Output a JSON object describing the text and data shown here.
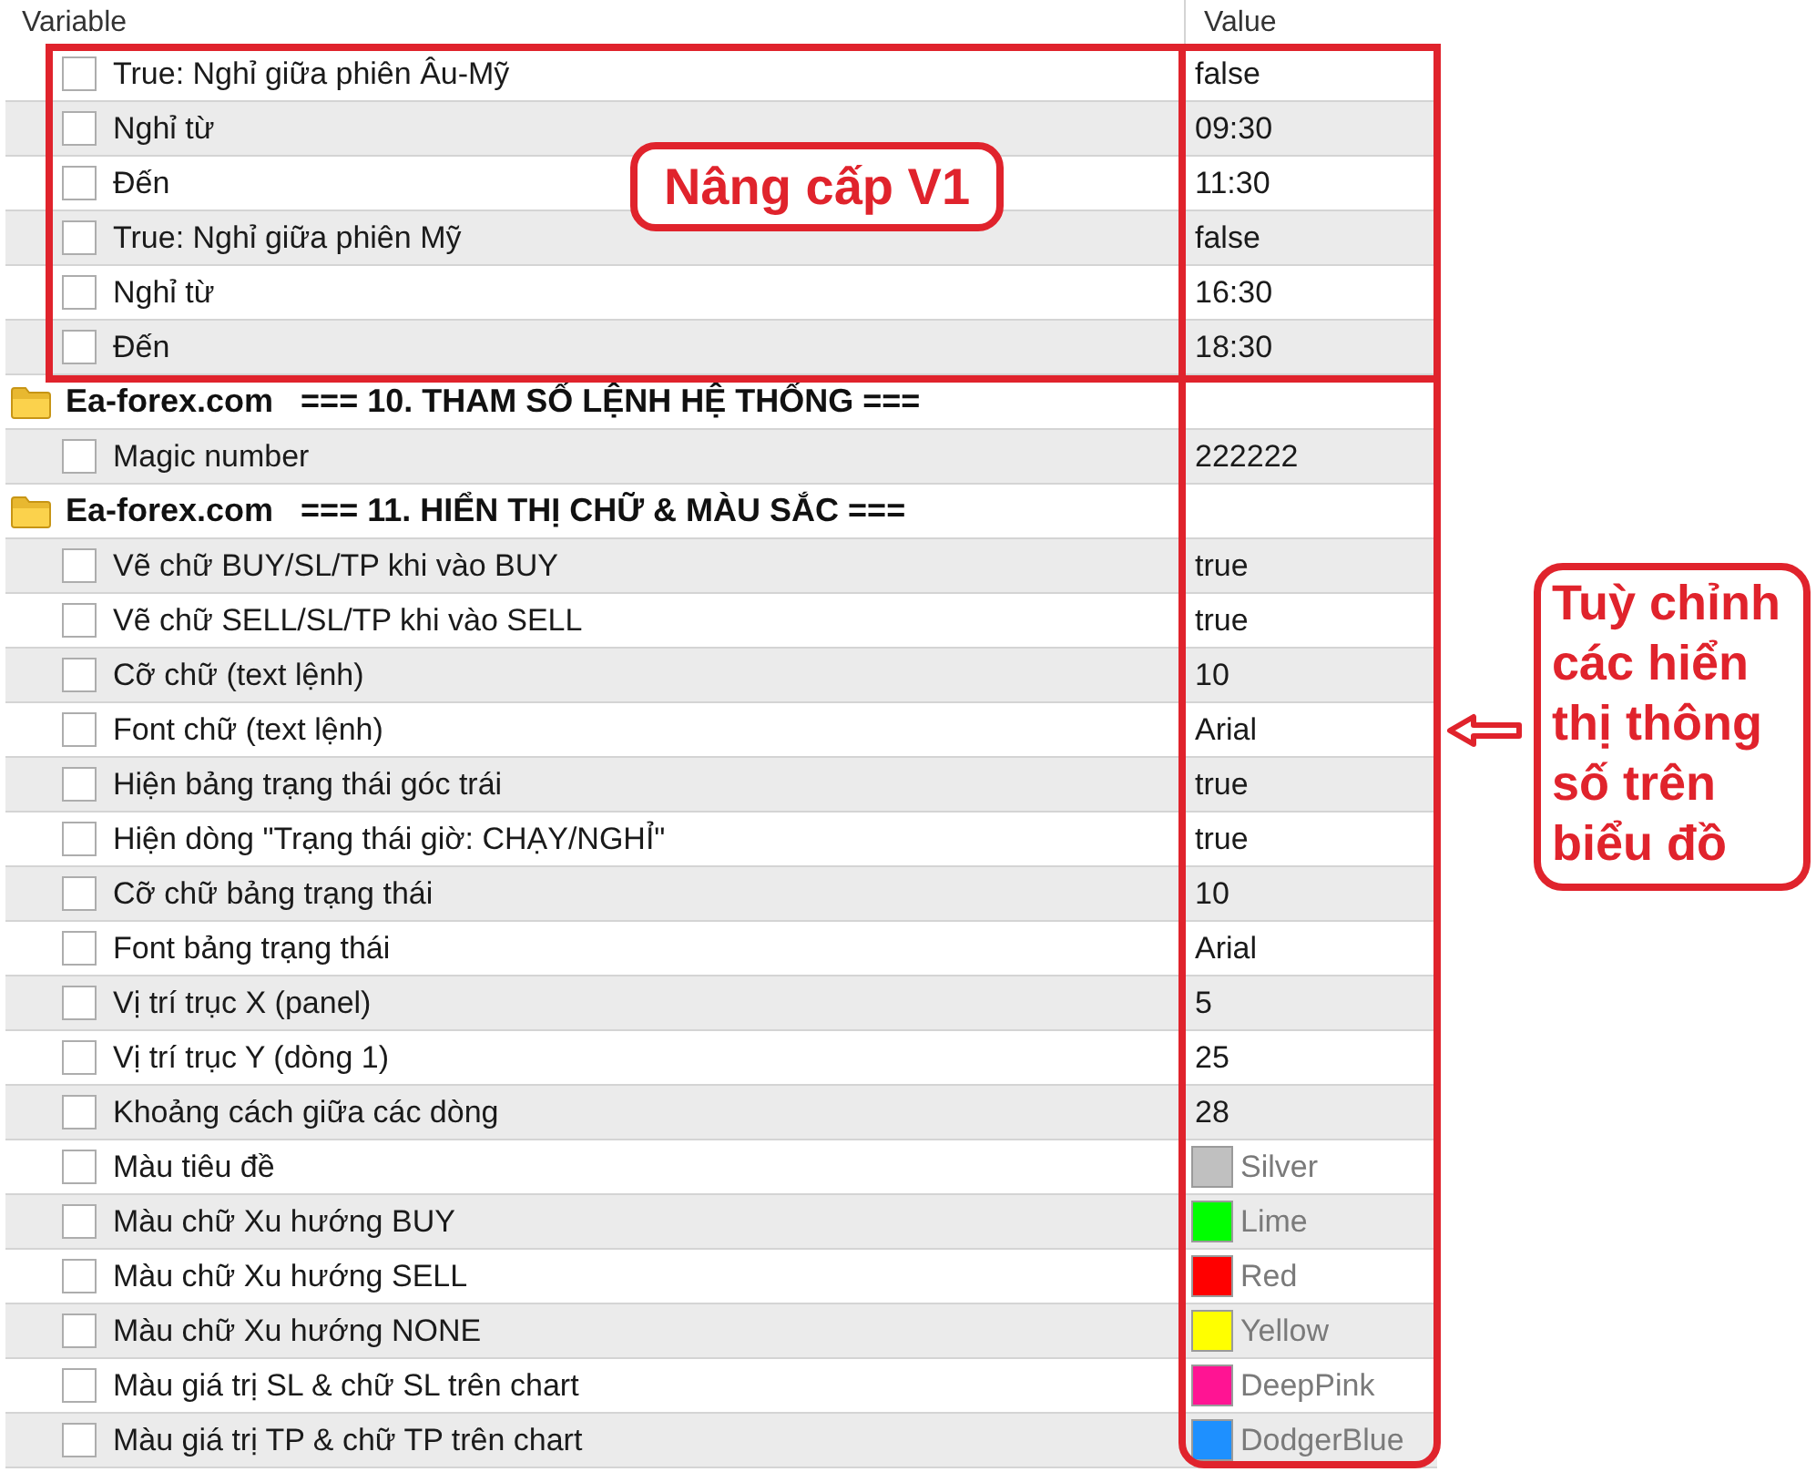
{
  "table": {
    "columns": [
      "Variable",
      "Value"
    ],
    "rows": [
      {
        "kind": "param",
        "name": "True: Nghỉ giữa phiên Âu-Mỹ",
        "value": "false",
        "checked": false
      },
      {
        "kind": "param",
        "name": "Nghỉ từ",
        "value": "09:30",
        "checked": false
      },
      {
        "kind": "param",
        "name": "Đến",
        "value": "11:30",
        "checked": false
      },
      {
        "kind": "param",
        "name": "True: Nghỉ giữa phiên Mỹ",
        "value": "false",
        "checked": false
      },
      {
        "kind": "param",
        "name": "Nghỉ từ",
        "value": "16:30",
        "checked": false
      },
      {
        "kind": "param",
        "name": "Đến",
        "value": "18:30",
        "checked": false
      },
      {
        "kind": "group",
        "site": "Ea-forex.com",
        "title": "=== 10. THAM SỐ LỆNH HỆ THỐNG ==="
      },
      {
        "kind": "param",
        "name": "Magic number",
        "value": "222222",
        "checked": false
      },
      {
        "kind": "group",
        "site": "Ea-forex.com",
        "title": "=== 11. HIỂN THỊ CHỮ & MÀU SẮC ==="
      },
      {
        "kind": "param",
        "name": "Vẽ chữ BUY/SL/TP khi vào BUY",
        "value": "true",
        "checked": false
      },
      {
        "kind": "param",
        "name": "Vẽ chữ SELL/SL/TP khi vào SELL",
        "value": "true",
        "checked": false
      },
      {
        "kind": "param",
        "name": "Cỡ chữ (text lệnh)",
        "value": "10",
        "checked": false
      },
      {
        "kind": "param",
        "name": "Font chữ (text lệnh)",
        "value": "Arial",
        "checked": false
      },
      {
        "kind": "param",
        "name": "Hiện bảng trạng thái góc trái",
        "value": "true",
        "checked": false
      },
      {
        "kind": "param",
        "name": "Hiện dòng \"Trạng thái giờ: CHẠY/NGHỈ\"",
        "value": "true",
        "checked": false
      },
      {
        "kind": "param",
        "name": "Cỡ chữ bảng trạng thái",
        "value": "10",
        "checked": false
      },
      {
        "kind": "param",
        "name": "Font bảng trạng thái",
        "value": "Arial",
        "checked": false
      },
      {
        "kind": "param",
        "name": "Vị trí trục X (panel)",
        "value": "5",
        "checked": false
      },
      {
        "kind": "param",
        "name": "Vị trí trục Y (dòng 1)",
        "value": "25",
        "checked": false
      },
      {
        "kind": "param",
        "name": "Khoảng cách giữa các dòng",
        "value": "28",
        "checked": false
      },
      {
        "kind": "color",
        "name": "Màu tiêu đề",
        "value": "Silver",
        "color": "#c0c0c0",
        "checked": false
      },
      {
        "kind": "color",
        "name": "Màu chữ Xu hướng BUY",
        "value": "Lime",
        "color": "#00ff00",
        "checked": false
      },
      {
        "kind": "color",
        "name": "Màu chữ Xu hướng SELL",
        "value": "Red",
        "color": "#ff0000",
        "checked": false
      },
      {
        "kind": "color",
        "name": "Màu chữ Xu hướng NONE",
        "value": "Yellow",
        "color": "#ffff00",
        "checked": false
      },
      {
        "kind": "color",
        "name": "Màu giá trị SL & chữ SL trên chart",
        "value": "DeepPink",
        "color": "#ff1493",
        "checked": false
      },
      {
        "kind": "color",
        "name": "Màu giá trị TP & chữ TP trên chart",
        "value": "DodgerBlue",
        "color": "#1e90ff",
        "checked": false
      }
    ]
  },
  "annotations": [
    {
      "kind": "label",
      "text": "Nâng cấp V1"
    },
    {
      "kind": "callout",
      "text": "Tuỳ chỉnh các hiển thị thông số trên biểu đồ"
    }
  ]
}
